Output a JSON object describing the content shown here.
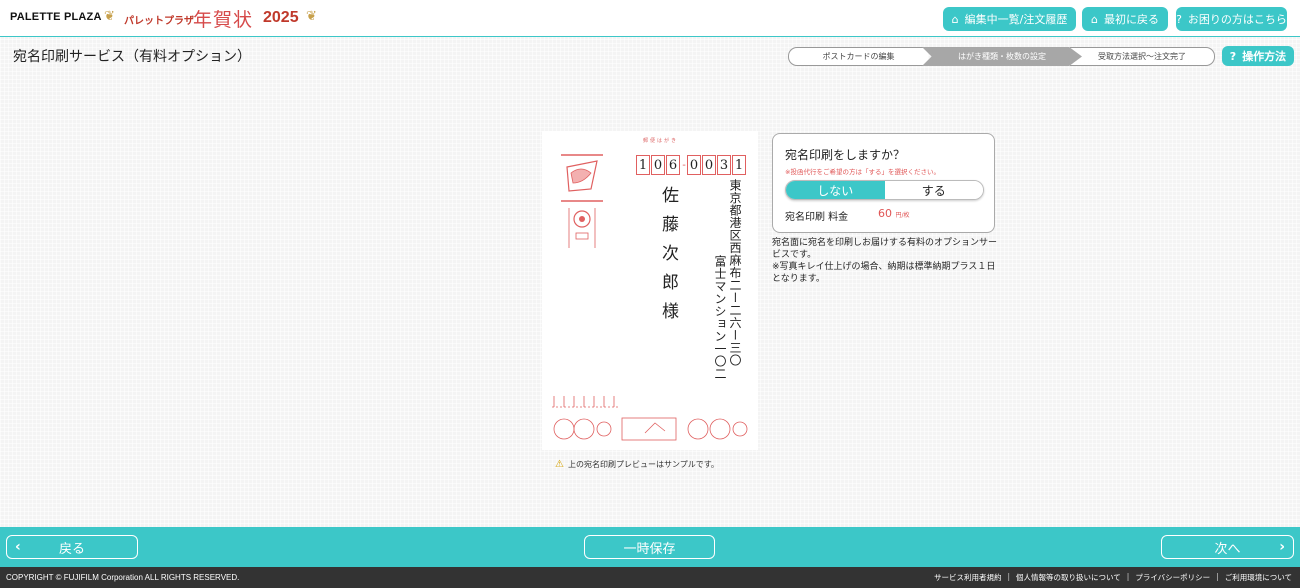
{
  "header": {
    "brand": "PALETTE PLAZA",
    "brand_jp": "パレットプラザ",
    "nenga": "年賀状",
    "year": "2025",
    "buttons": [
      {
        "label": "編集中一覧/注文履歴",
        "icon": "home-icon"
      },
      {
        "label": "最初に戻る",
        "icon": "home-icon"
      },
      {
        "label": "お困りの方はこちら",
        "icon": "question-icon"
      }
    ]
  },
  "page_title": "宛名印刷サービス（有料オプション）",
  "steps": [
    "ポストカードの編集",
    "はがき種類・枚数の設定",
    "受取方法選択〜注文完了"
  ],
  "help_button": "操作方法",
  "postcard": {
    "label": "郵便はがき",
    "zip": [
      "1",
      "0",
      "6",
      "0",
      "0",
      "3",
      "1"
    ],
    "address1": "東京都港区西麻布二ー二六ー三〇",
    "address2": "富士マンション一〇二",
    "name": "佐藤次郎様"
  },
  "notice": "上の宛名印刷プレビューはサンプルです。",
  "panel": {
    "title": "宛名印刷をしますか？",
    "note": "※投函代行をご希望の方は「する」を選択ください。",
    "off_label": "しない",
    "on_label": "する",
    "fee_label": "宛名印刷 料金",
    "fee_value": "60",
    "fee_unit": "円/枚"
  },
  "description": "宛名面に宛名を印刷しお届けする有料のオプションサービスです。\n※写真キレイ仕上げの場合、納期は標準納期プラス１日となります。",
  "footer": {
    "back": "戻る",
    "save": "一時保存",
    "next": "次へ"
  },
  "copyright": "COPYRIGHT © FUJIFILM Corporation ALL RIGHTS RESERVED.",
  "links": [
    "サービス利用者規約",
    "個人情報等の取り扱いについて",
    "プライバシーポリシー",
    "ご利用環境について"
  ],
  "colors": {
    "accent": "#3cc7c8",
    "red": "#e05555"
  }
}
